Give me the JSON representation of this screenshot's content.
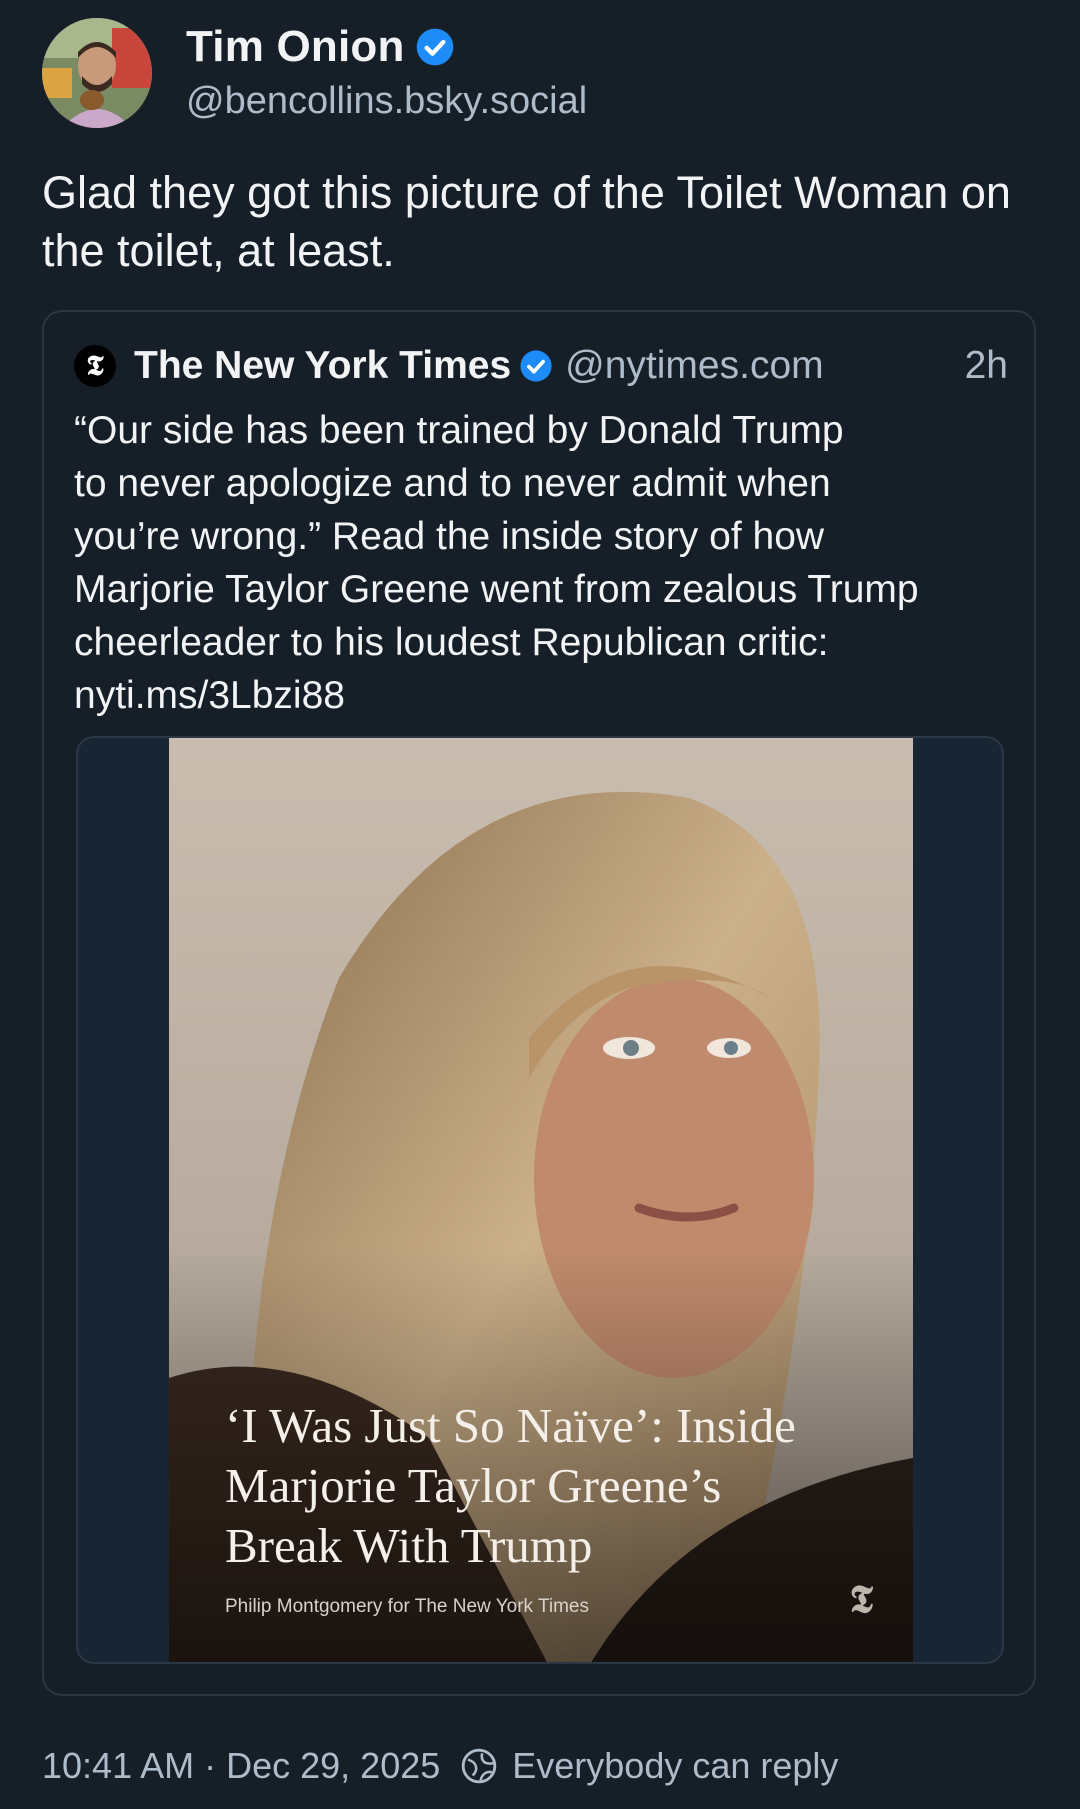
{
  "author": {
    "display_name": "Tim Onion",
    "handle": "@bencollins.bsky.social",
    "verified": true
  },
  "post_text": "Glad they got this picture of the Toilet Woman on the toilet, at least.",
  "quoted_post": {
    "display_name": "The New York Times",
    "handle": "@nytimes.com",
    "verified": true,
    "time_ago": "2h",
    "text": "“Our side has been trained by Donald Trump\nto never apologize and to never admit when\nyou’re wrong.” Read the inside story of how\nMarjorie Taylor Greene went from zealous Trump\ncheerleader to his loudest Republican critic:",
    "link": "nyti.ms/3Lbzi88",
    "image": {
      "headline": "‘I Was Just So Naïve’: Inside\nMarjorie Taylor Greene’s\nBreak With Trump",
      "credit": "Philip Montgomery for The New York Times"
    }
  },
  "footer": {
    "time": "10:41 AM",
    "date": "Dec 29, 2025",
    "separator": "·",
    "reply_setting": "Everybody can reply"
  },
  "colors": {
    "background": "#161e27",
    "text": "#f1f3f5",
    "muted": "#aebbc9",
    "verified": "#1d8cf8",
    "border": "#2a3744"
  },
  "icons": [
    "verified-badge-icon",
    "nyt-logo-icon",
    "everybody-can-reply-icon"
  ]
}
